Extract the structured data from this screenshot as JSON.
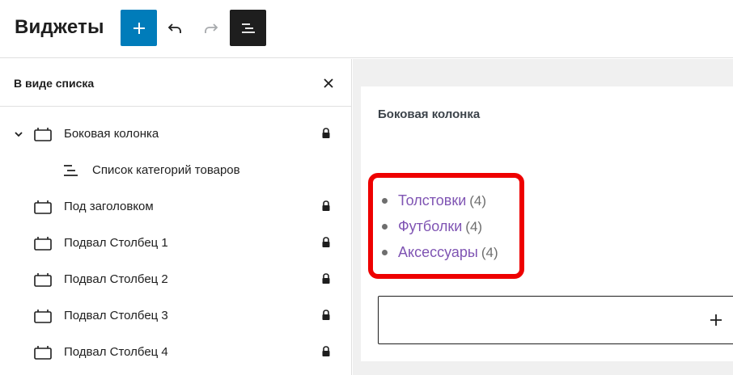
{
  "header": {
    "title": "Виджеты",
    "icons": {
      "add": "plus-icon",
      "undo": "undo-icon",
      "redo": "redo-icon",
      "list_view": "list-view-icon"
    },
    "colors": {
      "add_button": "#007cba",
      "list_view_button": "#1e1e1e",
      "redo_disabled": "#a7aaad"
    }
  },
  "sidebar": {
    "title": "В виде списка",
    "close_icon": "close-icon",
    "items": [
      {
        "label": "Боковая колонка",
        "expanded": true,
        "locked": true,
        "icon": "widget-area-icon"
      },
      {
        "label": "Список категорий товаров",
        "child": true,
        "locked": false,
        "icon": "category-list-icon"
      },
      {
        "label": "Под заголовком",
        "locked": true,
        "icon": "widget-area-icon"
      },
      {
        "label": "Подвал Столбец 1",
        "locked": true,
        "icon": "widget-area-icon"
      },
      {
        "label": "Подвал Столбец 2",
        "locked": true,
        "icon": "widget-area-icon"
      },
      {
        "label": "Подвал Столбец 3",
        "locked": true,
        "icon": "widget-area-icon"
      },
      {
        "label": "Подвал Столбец 4",
        "locked": true,
        "icon": "widget-area-icon"
      }
    ]
  },
  "canvas": {
    "area_title": "Боковая колонка",
    "categories": [
      {
        "name": "Толстовки",
        "count": "(4)"
      },
      {
        "name": "Футболки",
        "count": "(4)"
      },
      {
        "name": "Аксессуары",
        "count": "(4)"
      }
    ],
    "link_color": "#7f54b3",
    "highlight_color": "#ee0000",
    "appender_icon": "plus-icon"
  }
}
